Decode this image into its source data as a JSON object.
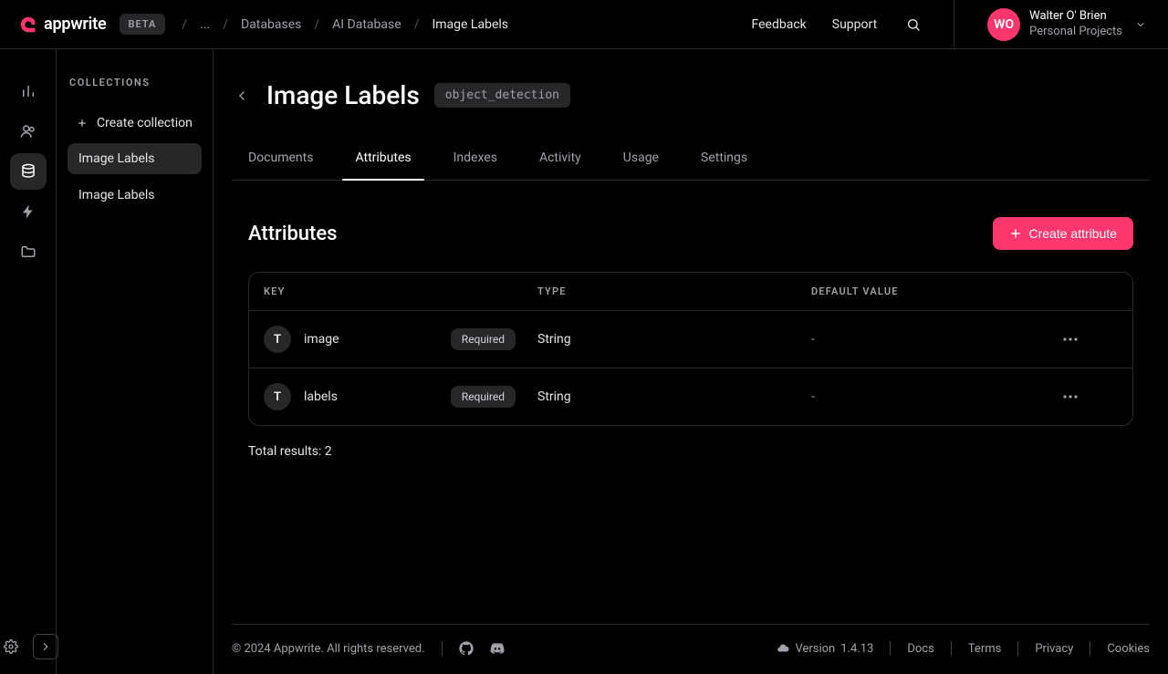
{
  "brand": {
    "name": "appwrite",
    "beta_label": "BETA"
  },
  "breadcrumb": {
    "ellipsis": "...",
    "items": [
      "Databases",
      "AI Database",
      "Image Labels"
    ]
  },
  "topbar": {
    "feedback": "Feedback",
    "support": "Support"
  },
  "user": {
    "initials": "WO",
    "name": "Walter O' Brien",
    "org": "Personal Projects"
  },
  "sidebar": {
    "heading": "COLLECTIONS",
    "create_label": "Create collection",
    "items": [
      "Image Labels",
      "Image Labels"
    ],
    "selected_index": 0
  },
  "page": {
    "title": "Image Labels",
    "collection_id": "object_detection"
  },
  "tabs": {
    "items": [
      "Documents",
      "Attributes",
      "Indexes",
      "Activity",
      "Usage",
      "Settings"
    ],
    "active_index": 1
  },
  "section": {
    "title": "Attributes",
    "create_button": "Create attribute"
  },
  "table": {
    "headers": {
      "key": "KEY",
      "type": "TYPE",
      "default": "DEFAULT VALUE"
    },
    "required_label": "Required",
    "type_icon_glyph": "T",
    "rows": [
      {
        "key": "image",
        "type": "String",
        "required": true,
        "default": "-"
      },
      {
        "key": "labels",
        "type": "String",
        "required": true,
        "default": "-"
      }
    ],
    "total_prefix": "Total results: ",
    "total": "2"
  },
  "footer": {
    "copyright": "© 2024 Appwrite. All rights reserved.",
    "version_prefix": "Version ",
    "version": "1.4.13",
    "links": [
      "Docs",
      "Terms",
      "Privacy",
      "Cookies"
    ]
  }
}
